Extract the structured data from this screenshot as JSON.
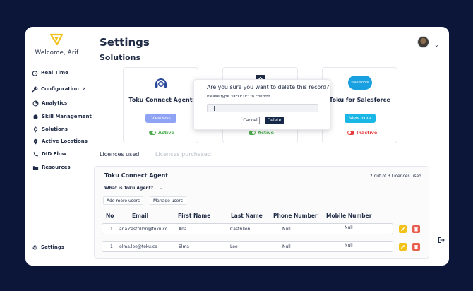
{
  "sidebar": {
    "welcome": "Welcome, Arif",
    "items": [
      {
        "label": "Real Time",
        "icon": "alarm-clock-icon"
      },
      {
        "label": "Configuration",
        "icon": "wrench-icon"
      },
      {
        "label": "Analytics",
        "icon": "analytics-icon"
      },
      {
        "label": "Skill Management",
        "icon": "brain-icon"
      },
      {
        "label": "Solutions",
        "icon": "lightbulb-icon"
      },
      {
        "label": "Active Locations",
        "icon": "location-pin-icon"
      },
      {
        "label": "DID Flow",
        "icon": "phone-icon"
      },
      {
        "label": "Resources",
        "icon": "folder-icon"
      }
    ],
    "settings_label": "Settings"
  },
  "header": {
    "title": "Settings",
    "section": "Solutions"
  },
  "cards": [
    {
      "name": "Toku Connect Agent",
      "button": "View less",
      "status": "Active",
      "button_color": "#8fa3f5",
      "status_color": "#4cae4f"
    },
    {
      "name": "",
      "button": "",
      "status": "Active",
      "status_color": "#4cae4f"
    },
    {
      "name": "Toku for Salesforce",
      "button": "View more",
      "status": "Inactive",
      "button_color": "#19b6e6",
      "status_color": "#e53e3e",
      "logo_text": "salesforce"
    }
  ],
  "tabs": [
    "Licences used",
    "Licences purchased"
  ],
  "panel": {
    "title": "Toku Connect Agent",
    "count": "2 out of 3 Licences used",
    "link": "What is Toku Agent?",
    "add_button": "Add more users",
    "manage_button": "Manage users",
    "columns": [
      "No",
      "Email",
      "First Name",
      "Last Name",
      "Phone Number",
      "Mobile Number"
    ],
    "rows": [
      {
        "no": "1",
        "email": "ana.castrillon@toku.co",
        "first": "Ana",
        "last": "Castrillon",
        "phone": "Null",
        "mobile": "Null"
      },
      {
        "no": "1",
        "email": "elma.lee@toku.co",
        "first": "Elma",
        "last": "Lee",
        "phone": "Null",
        "mobile": "Null"
      }
    ]
  },
  "modal": {
    "title": "Are you sure you want to delete this record?",
    "label": "Please type \"DELETE\" to confirm",
    "input_value": "",
    "cancel": "Cancel",
    "delete": "Delete"
  },
  "colors": {
    "background": "#0c1638",
    "brand_yellow": "#f2c21b",
    "primary_dark": "#16284a",
    "active_green": "#4cae4f",
    "inactive_red": "#e53e3e"
  }
}
